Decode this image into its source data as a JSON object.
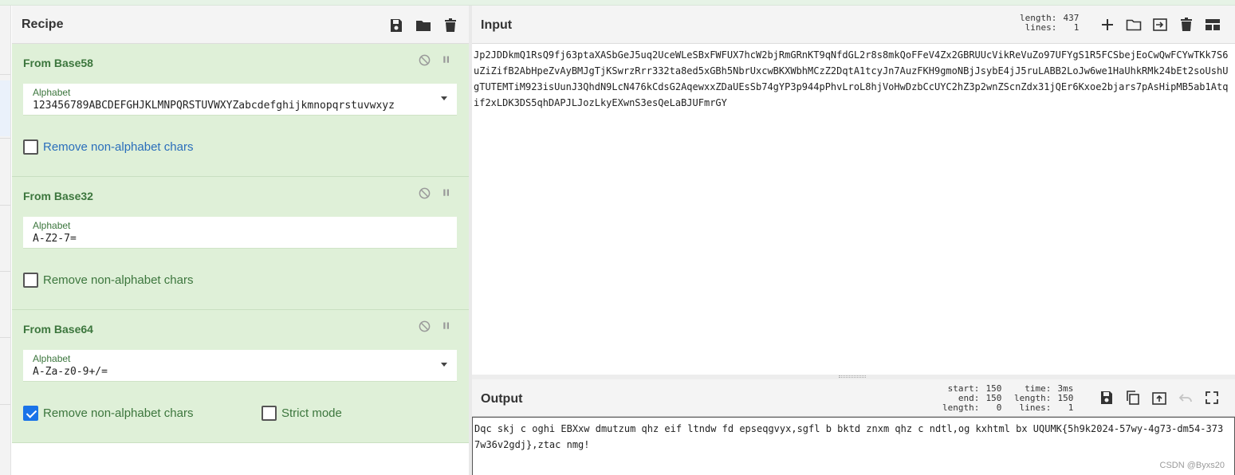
{
  "recipe": {
    "title": "Recipe",
    "icons": [
      "save-icon",
      "folder-icon",
      "trash-icon"
    ],
    "operations": [
      {
        "title": "From Base58",
        "alphabet_label": "Alphabet",
        "alphabet_value": "123456789ABCDEFGHJKLMNPQRSTUVWXYZabcdefghijkmnopqrstuvwxyz",
        "has_dropdown": true,
        "remove_label": "Remove non-alphabet chars",
        "remove_checked": false
      },
      {
        "title": "From Base32",
        "alphabet_label": "Alphabet",
        "alphabet_value": "A-Z2-7=",
        "has_dropdown": false,
        "remove_label": "Remove non-alphabet chars",
        "remove_checked": false
      },
      {
        "title": "From Base64",
        "alphabet_label": "Alphabet",
        "alphabet_value": "A-Za-z0-9+/=",
        "has_dropdown": true,
        "remove_label": "Remove non-alphabet chars",
        "remove_checked": true,
        "strict_label": "Strict mode",
        "strict_checked": false
      }
    ]
  },
  "input": {
    "title": "Input",
    "length_label": "length:",
    "length_value": "437",
    "lines_label": "lines:",
    "lines_value": "1",
    "icons": [
      "plus-icon",
      "folder-icon",
      "import-icon",
      "trash-icon",
      "layout-icon"
    ],
    "text": "Jp2JDDkmQ1RsQ9fj63ptaXASbGeJ5uq2UceWLeSBxFWFUX7hcW2bjRmGRnKT9qNfdGL2r8s8mkQoFFeV4Zx2GBRUUcVikReVuZo97UFYgS1R5FCSbejEoCwQwFCYwTKk7S6uZiZifB2AbHpeZvAyBMJgTjKSwrzRrr332ta8ed5xGBh5NbrUxcwBKXWbhMCzZ2DqtA1tcyJn7AuzFKH9gmoNBjJsybE4jJ5ruLABB2LoJw6we1HaUhkRMk24bEt2soUshUgTUTEMTiM923isUunJ3QhdN9LcN476kCdsG2AqewxxZDaUEsSb74gYP3p944pPhvLroL8hjVoHwDzbCcUYC2hZ3p2wnZScnZdx31jQEr6Kxoe2bjars7pAsHipMB5ab1Atqif2xLDK3DS5qhDAPJLJozLkyEXwnS3esQeLaBJUFmrGY"
  },
  "output": {
    "title": "Output",
    "start_label": "start:",
    "start_value": "150",
    "end_label": "end:",
    "end_value": "150",
    "length_label": "length:",
    "length_value": "0",
    "time_label": "time:",
    "time_value": "3ms",
    "olength_label": "length:",
    "olength_value": "150",
    "lines_label": "lines:",
    "lines_value": "1",
    "icons": [
      "save-icon",
      "copy-icon",
      "replace-input-icon",
      "undo-icon",
      "fullscreen-icon"
    ],
    "text": "Dqc skj c oghi EBXxw dmutzum qhz eif ltndw fd epseqgvyx,sgfl b bktd znxm qhz c ndtl,og kxhtml bx UQUMK{5h9k2024-57wy-4g73-dm54-3737w36v2gdj},ztac nmg!",
    "watermark": "CSDN @Byxs20"
  },
  "colors": {
    "op_bg": "#dff0d8",
    "op_title": "#3c763d",
    "checkbox_checked": "#1a73e8"
  }
}
